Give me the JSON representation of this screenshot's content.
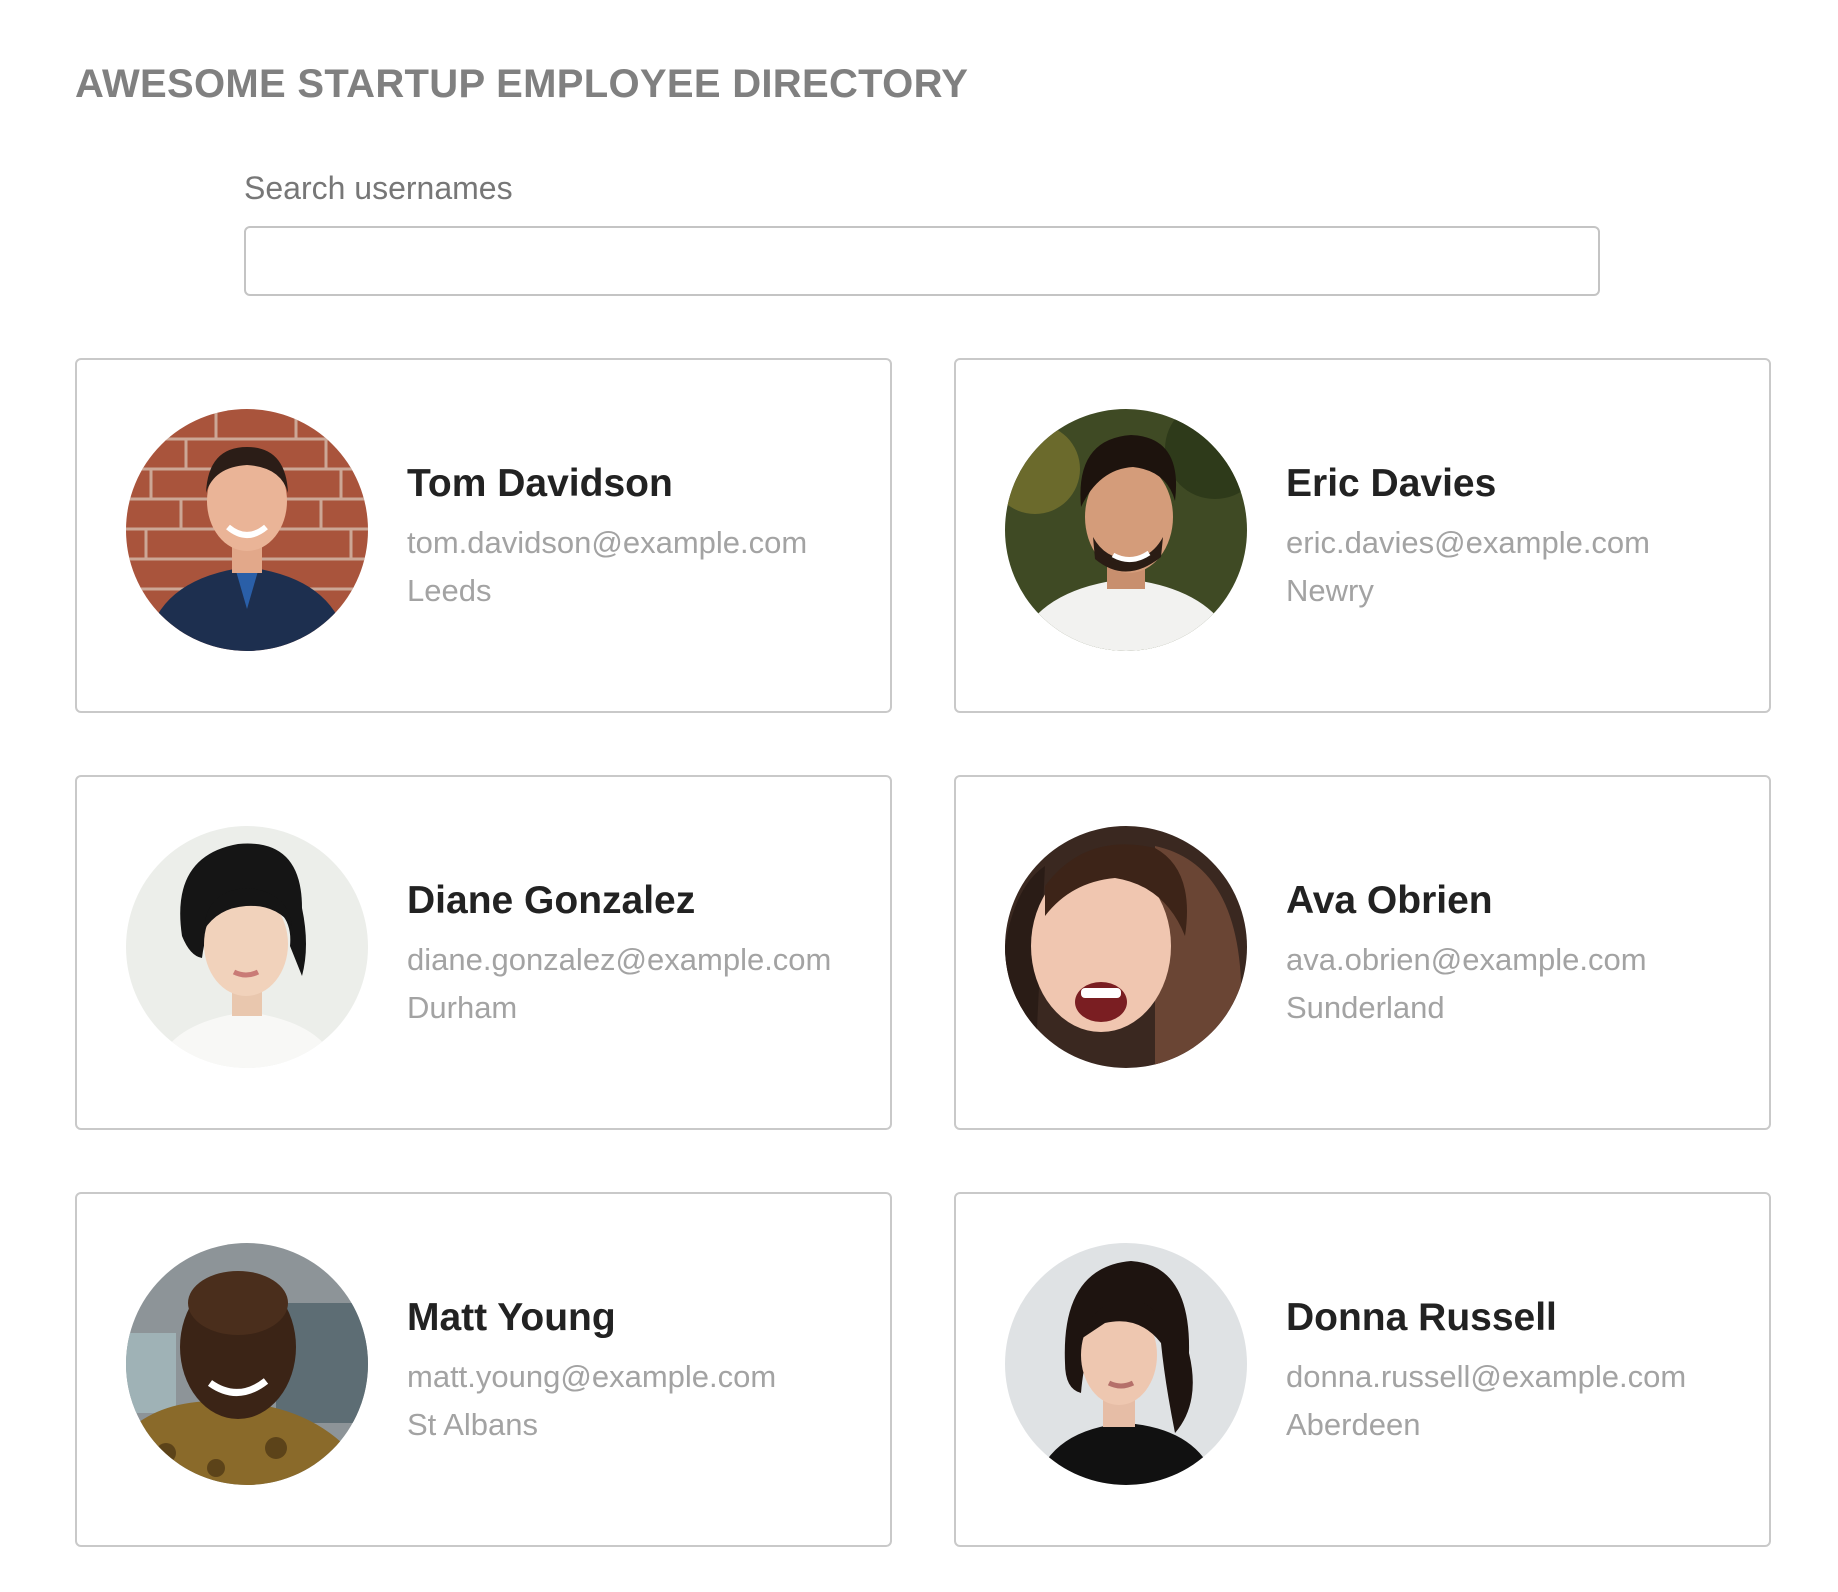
{
  "header": {
    "title": "AWESOME STARTUP EMPLOYEE DIRECTORY"
  },
  "search": {
    "label": "Search usernames",
    "value": "",
    "placeholder": ""
  },
  "employees": [
    {
      "name": "Tom Davidson",
      "email": "tom.davidson@example.com",
      "city": "Leeds",
      "avatar_icon": "avatar-photo"
    },
    {
      "name": "Eric Davies",
      "email": "eric.davies@example.com",
      "city": "Newry",
      "avatar_icon": "avatar-photo"
    },
    {
      "name": "Diane Gonzalez",
      "email": "diane.gonzalez@example.com",
      "city": "Durham",
      "avatar_icon": "avatar-photo"
    },
    {
      "name": "Ava Obrien",
      "email": "ava.obrien@example.com",
      "city": "Sunderland",
      "avatar_icon": "avatar-photo"
    },
    {
      "name": "Matt Young",
      "email": "matt.young@example.com",
      "city": "St Albans",
      "avatar_icon": "avatar-photo"
    },
    {
      "name": "Donna Russell",
      "email": "donna.russell@example.com",
      "city": "Aberdeen",
      "avatar_icon": "avatar-photo"
    }
  ],
  "colors": {
    "title": "#808080",
    "name": "#222222",
    "secondary_text": "#a3a3a3",
    "card_border": "#c9c9c9"
  }
}
